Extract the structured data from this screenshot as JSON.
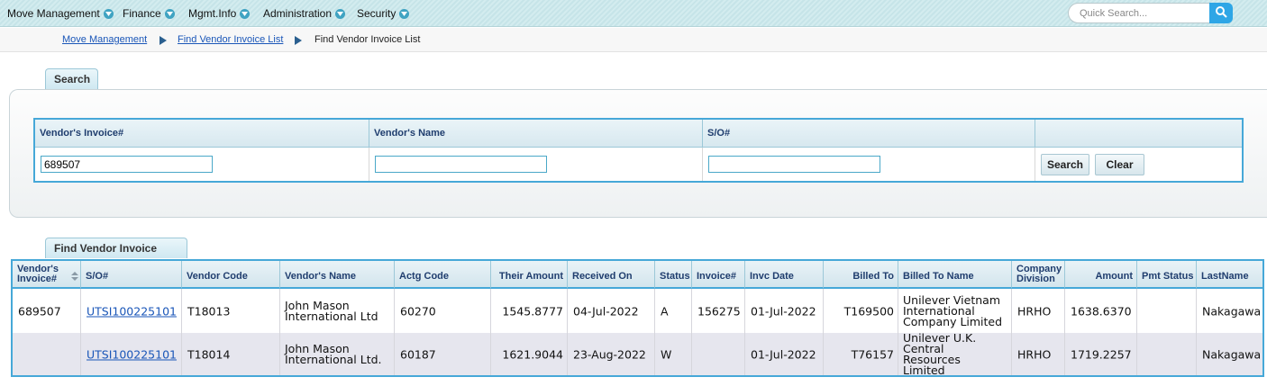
{
  "nav": {
    "menu": [
      {
        "label": "Move Management"
      },
      {
        "label": "Finance"
      },
      {
        "label": "Mgmt.Info"
      },
      {
        "label": "Administration"
      },
      {
        "label": "Security"
      }
    ],
    "quick_search_placeholder": "Quick Search..."
  },
  "breadcrumb": {
    "items": [
      "Move Management",
      "Find Vendor Invoice List",
      "Find Vendor Invoice List"
    ]
  },
  "search": {
    "tab_label": "Search",
    "headers": [
      "Vendor's Invoice#",
      "Vendor's Name",
      "S/O#"
    ],
    "vendor_invoice_value": "689507",
    "vendor_name_value": "",
    "so_value": "",
    "search_label": "Search",
    "clear_label": "Clear"
  },
  "results": {
    "tab_label": "Find Vendor Invoice List",
    "columns": [
      {
        "line1": "Vendor's",
        "line2": "Invoice#"
      },
      {
        "line1": "S/O#"
      },
      {
        "line1": "Vendor Code"
      },
      {
        "line1": "Vendor's Name"
      },
      {
        "line1": "Actg Code"
      },
      {
        "line1": "Their Amount"
      },
      {
        "line1": "Received On"
      },
      {
        "line1": "Status"
      },
      {
        "line1": "Invoice#"
      },
      {
        "line1": "Invc Date"
      },
      {
        "line1": "Billed To"
      },
      {
        "line1": "Billed To Name"
      },
      {
        "line1": "Company",
        "line2": "Division"
      },
      {
        "line1": "Amount"
      },
      {
        "line1": "Pmt Status"
      },
      {
        "line1": "LastName"
      }
    ],
    "rows": [
      {
        "vendor_invoice": "689507",
        "so": "UTSI100225101",
        "vendor_code": "T18013",
        "vendor_name": "John Mason International Ltd",
        "actg_code": "60270",
        "their_amount": "1545.8777",
        "received_on": "04-Jul-2022",
        "status": "A",
        "invoice": "156275",
        "invc_date": "01-Jul-2022",
        "billed_to": "T169500",
        "billed_to_name": "Unilever Vietnam International Company Limited",
        "company_division": "HRHO",
        "amount": "1638.6370",
        "pmt_status": "",
        "last_name": "Nakagawa"
      },
      {
        "vendor_invoice": "",
        "so": "UTSI100225101",
        "vendor_code": "T18014",
        "vendor_name": "John Mason International Ltd.",
        "actg_code": "60187",
        "their_amount": "1621.9044",
        "received_on": "23-Aug-2022",
        "status": "W",
        "invoice": "",
        "invc_date": "01-Jul-2022",
        "billed_to": "T76157",
        "billed_to_name": "Unilever U.K. Central Resources Limited",
        "company_division": "HRHO",
        "amount": "1719.2257",
        "pmt_status": "",
        "last_name": "Nakagawa"
      }
    ]
  }
}
